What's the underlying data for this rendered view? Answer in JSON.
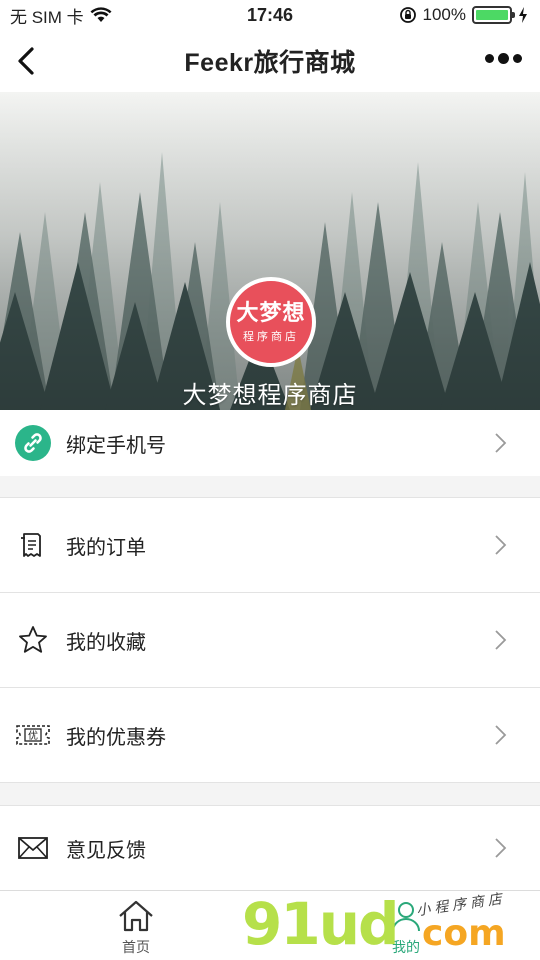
{
  "status_bar": {
    "carrier": "无 SIM 卡",
    "time": "17:46",
    "battery_percent": "100%",
    "battery_level": 1.0,
    "icons": [
      "wifi-icon",
      "orientation-lock-icon",
      "battery-icon",
      "charging-icon"
    ]
  },
  "nav": {
    "title": "Feekr旅行商城",
    "back_icon": "chevron-left-icon",
    "more_icon": "more-dots-icon"
  },
  "hero": {
    "avatar_main": "大梦想",
    "avatar_sub": "程序商店",
    "store_name": "大梦想程序商店",
    "avatar_color": "#e8505b"
  },
  "menu": {
    "bind_phone": {
      "label": "绑定手机号",
      "icon": "link-icon",
      "icon_color": "#2bb58a"
    },
    "orders": {
      "label": "我的订单",
      "icon": "receipt-icon"
    },
    "favorites": {
      "label": "我的收藏",
      "icon": "star-icon"
    },
    "coupons": {
      "label": "我的优惠券",
      "icon": "coupon-icon",
      "icon_text": "优"
    },
    "feedback": {
      "label": "意见反馈",
      "icon": "envelope-icon"
    }
  },
  "tabbar": {
    "home_label": "首页",
    "mine_label": "我的",
    "active_color": "#2aa87a"
  },
  "watermark": {
    "main": "91ud",
    "com": "com",
    "sub": "小程序商店"
  }
}
